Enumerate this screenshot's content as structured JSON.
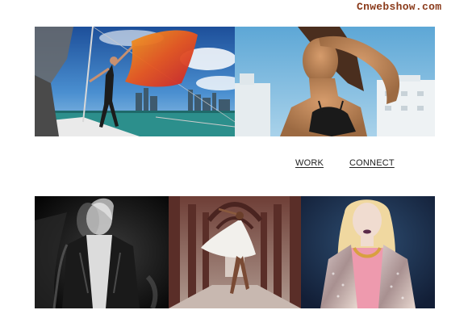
{
  "watermark": {
    "text": "Cnwebshow.com",
    "color": "#8a3a1a"
  },
  "nav": {
    "items": [
      {
        "label": "WORK "
      },
      {
        "label": "CONNECT "
      }
    ]
  },
  "gallery": {
    "top_row": [
      {
        "subject": "model-sailboat-orange-scarf"
      },
      {
        "subject": "model-shading-eyes-bikini"
      }
    ],
    "bottom_row": [
      {
        "subject": "model-black-leather-jacket-bw"
      },
      {
        "subject": "dancer-white-dress-arcade"
      },
      {
        "subject": "blonde-model-sequin-jacket"
      }
    ]
  },
  "colors": {
    "sky": "#2a6fb6",
    "sea": "#2c8f8c",
    "scarf": "#e8561e",
    "light_sky": "#8fc2e0",
    "skin": "#c08a5a",
    "arcade": "#8a5a4e",
    "navy_bg": "#203a5a",
    "pink": "#e8a0b0"
  }
}
